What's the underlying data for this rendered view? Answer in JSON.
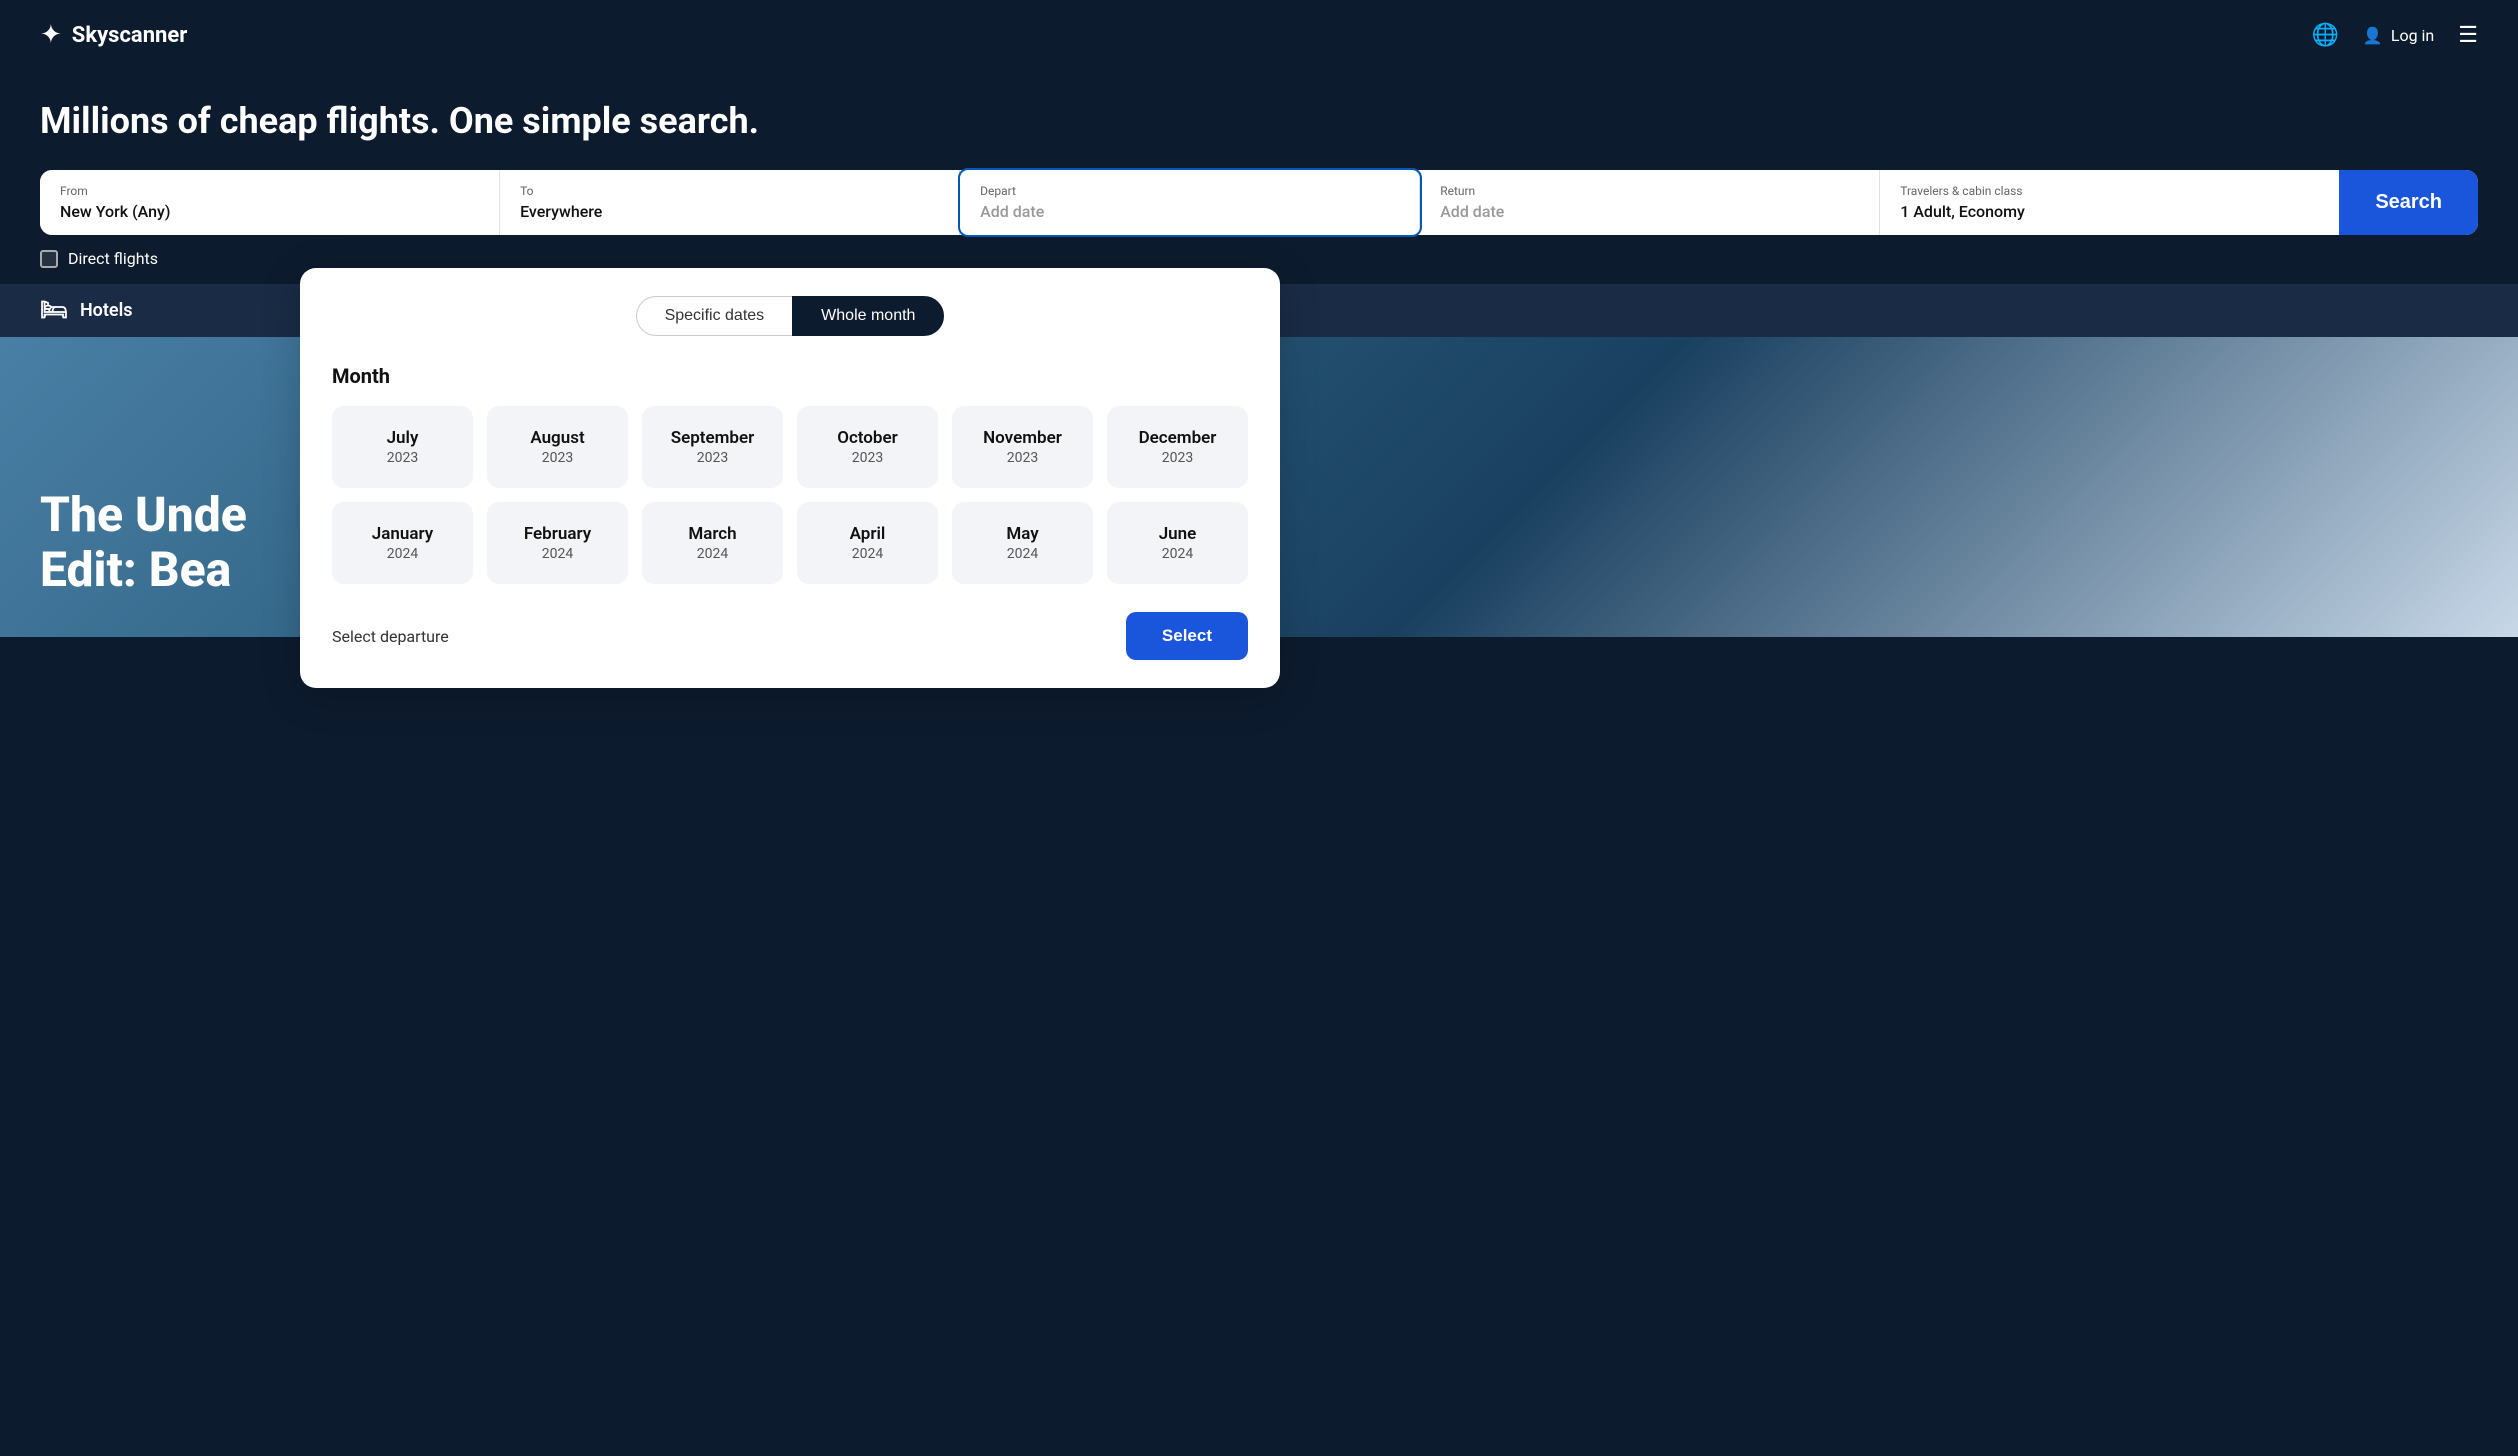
{
  "header": {
    "logo_text": "Skyscanner",
    "login_label": "Log in"
  },
  "headline": "Millions of cheap flights. One simple search.",
  "search": {
    "from_label": "From",
    "from_value": "New York (Any)",
    "to_label": "To",
    "to_value": "Everywhere",
    "depart_label": "Depart",
    "depart_placeholder": "Add date",
    "return_label": "Return",
    "return_placeholder": "Add date",
    "travelers_label": "Travelers & cabin class",
    "travelers_value": "1 Adult, Economy",
    "search_button": "Search"
  },
  "direct_flights": {
    "label": "Direct flights"
  },
  "hotels": {
    "label": "Hotels"
  },
  "hero": {
    "text_line1": "The Unde",
    "text_line2": "Edit: Bea"
  },
  "dropdown": {
    "toggle_specific": "Specific dates",
    "toggle_whole": "Whole month",
    "month_section_label": "Month",
    "months_row1": [
      {
        "name": "July",
        "year": "2023"
      },
      {
        "name": "August",
        "year": "2023"
      },
      {
        "name": "September",
        "year": "2023"
      },
      {
        "name": "October",
        "year": "2023"
      },
      {
        "name": "November",
        "year": "2023"
      },
      {
        "name": "December",
        "year": "2023"
      }
    ],
    "months_row2": [
      {
        "name": "January",
        "year": "2024"
      },
      {
        "name": "February",
        "year": "2024"
      },
      {
        "name": "March",
        "year": "2024"
      },
      {
        "name": "April",
        "year": "2024"
      },
      {
        "name": "May",
        "year": "2024"
      },
      {
        "name": "June",
        "year": "2024"
      }
    ],
    "footer_label": "Select departure",
    "select_button": "Select"
  }
}
